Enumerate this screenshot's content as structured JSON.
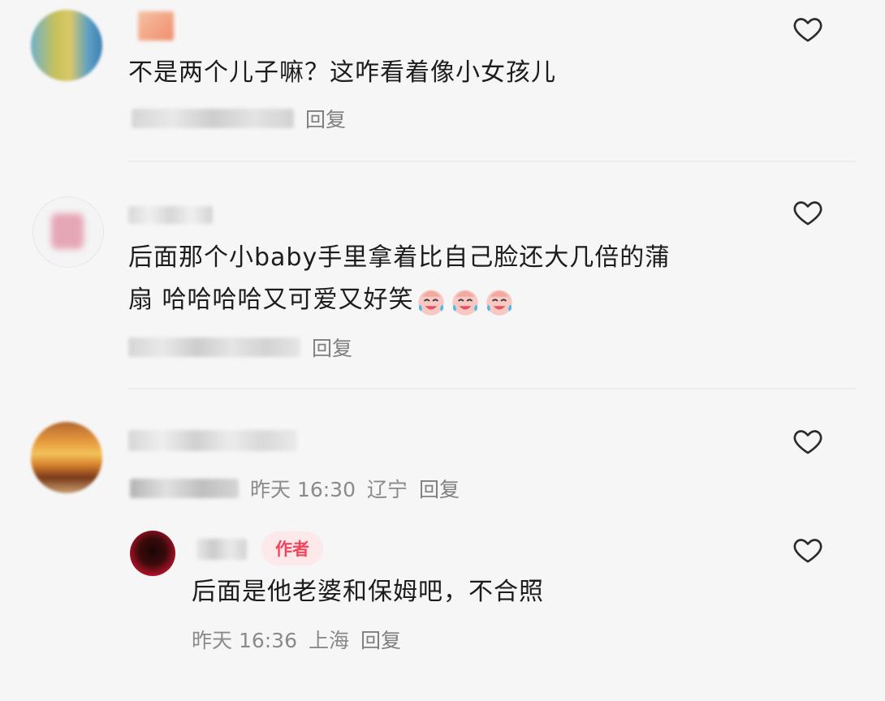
{
  "comments": [
    {
      "text": "不是两个儿子嘛？这咋看着像小女孩儿",
      "reply_label": "回复"
    },
    {
      "text_line1": "后面那个小baby手里拿着比自己脸还大几倍的蒲",
      "text_line2": "扇 哈哈哈哈又可爱又好笑",
      "emoji_name": "crying-laughing-face",
      "reply_label": "回复"
    },
    {
      "time": "昨天 16:30",
      "location": "辽宁",
      "reply_label": "回复",
      "reply": {
        "author_badge": "作者",
        "text": "后面是他老婆和保姆吧，不合照",
        "time": "昨天 16:36",
        "location": "上海",
        "reply_label": "回复"
      }
    }
  ],
  "colors": {
    "background": "#f6f6f7",
    "author_badge_text": "#f2455d",
    "author_badge_bg": "#fde8ea",
    "meta_text": "#8a8a8a"
  },
  "icons": [
    "heart-outline-icon"
  ]
}
